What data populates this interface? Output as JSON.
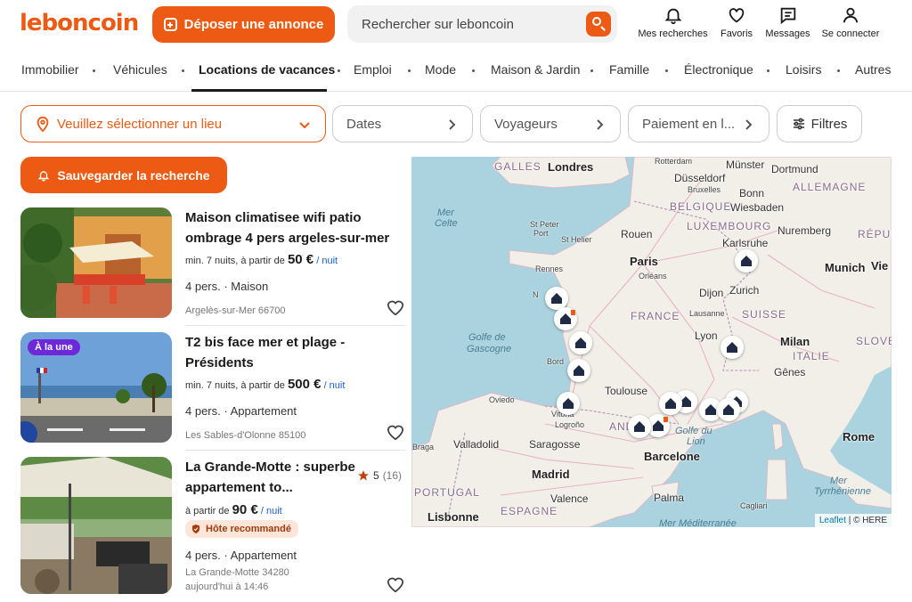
{
  "header": {
    "logo": "leboncoin",
    "post_label": "Déposer une annonce",
    "search_placeholder": "Rechercher sur leboncoin",
    "icons": [
      {
        "label": "Mes recherches",
        "icon": "bell-icon"
      },
      {
        "label": "Favoris",
        "icon": "heart-icon"
      },
      {
        "label": "Messages",
        "icon": "message-icon"
      },
      {
        "label": "Se connecter",
        "icon": "user-icon"
      }
    ]
  },
  "nav": [
    "Immobilier",
    "Véhicules",
    "Locations de vacances",
    "Emploi",
    "Mode",
    "Maison & Jardin",
    "Famille",
    "Électronique",
    "Loisirs",
    "Autres"
  ],
  "nav_active": "Locations de vacances",
  "filters": {
    "location": "Veuillez sélectionner un lieu",
    "dates": "Dates",
    "travelers": "Voyageurs",
    "payment": "Paiement en l...",
    "more": "Filtres"
  },
  "save_search_label": "Sauvegarder la recherche",
  "listings": [
    {
      "title": "Maison climatisee wifi patio ombrage 4 pers argeles-sur-mer",
      "price_prefix": "min. 7 nuits, à partir de",
      "price": "50 €",
      "unit": "/ nuit",
      "type": "4 pers. · Maison",
      "place": "Argelès-sur-Mer 66700"
    },
    {
      "badge": "À la une",
      "title": "T2 bis face mer et plage - Présidents",
      "price_prefix": "min. 7 nuits, à partir de",
      "price": "500 €",
      "unit": "/ nuit",
      "type": "4 pers. · Appartement",
      "place": "Les Sables-d'Olonne 85100"
    },
    {
      "title": "La Grande-Motte : superbe appartement to...",
      "rating": "5",
      "rating_count": "(16)",
      "price_prefix": "à partir de",
      "price": "90 €",
      "unit": "/ nuit",
      "badge_reco": "Hôte recommandé",
      "type": "4 pers. · Appartement",
      "place": "La Grande-Motte 34280",
      "time": "aujourd'hui à 14:46"
    }
  ],
  "map": {
    "colors": {
      "sea": "#aad3df",
      "land": "#f2efe9"
    },
    "labels": {
      "galles": "GALLES",
      "londres": "Londres",
      "rotterdam": "Rotterdam",
      "munster": "Münster",
      "dortmund": "Dortmund",
      "dusseldorf": "Düsseldorf",
      "bruxelles": "Bruxelles",
      "bonn": "Bonn",
      "allemagne": "ALLEMAGNE",
      "belgique": "BELGIQUE",
      "wiesbaden": "Wiesbaden",
      "luxembourg": "LUXEMBOURG",
      "nuremberg": "Nuremberg",
      "mer_celte_1": "Mer",
      "mer_celte_2": "Celte",
      "stpeter_1": "St Peter",
      "stpeter_2": "Port",
      "sthelier": "St Helier",
      "rouen": "Rouen",
      "karlsruhe": "Karlsruhe",
      "republique": "RÉPUBLI",
      "paris": "Paris",
      "rennes": "Rennes",
      "orleans": "Orléans",
      "munich": "Munich",
      "vienne": "Vie",
      "dijon": "Dijon",
      "zurich": "Zurich",
      "france": "FRANCE",
      "lausanne": "Lausanne",
      "suisse": "SUISSE",
      "golfe1": "Golfe de",
      "golfe2": "Gascogne",
      "lyon": "Lyon",
      "milan": "Milan",
      "italie": "ITALIE",
      "slove": "SLOVE",
      "bordeaux": "Bord",
      "genes": "Gênes",
      "nantes": "N",
      "oviedo": "Oviedo",
      "toulouse": "Toulouse",
      "vitoria": "Vitoria",
      "logrono": "Logroño",
      "andorre": "AND",
      "golfedulion1": "Golfe du",
      "golfedulion2": "Lion",
      "braga": "Braga",
      "valladolid": "Valladolid",
      "saragosse": "Saragosse",
      "rome": "Rome",
      "barcelone": "Barcelone",
      "portugal": "PORTUGAL",
      "madrid": "Madrid",
      "mertyr1": "Mer",
      "mertyr2": "Tyrrhénienne",
      "palma": "Palma",
      "valence": "Valence",
      "cagliari": "Cagliari",
      "lisbonne": "Lisbonne",
      "espagne": "ESPAGNE",
      "mermed": "Mer Méditerranée"
    },
    "attribution_link": "Leaflet",
    "attribution_rest": "| © HERE"
  }
}
